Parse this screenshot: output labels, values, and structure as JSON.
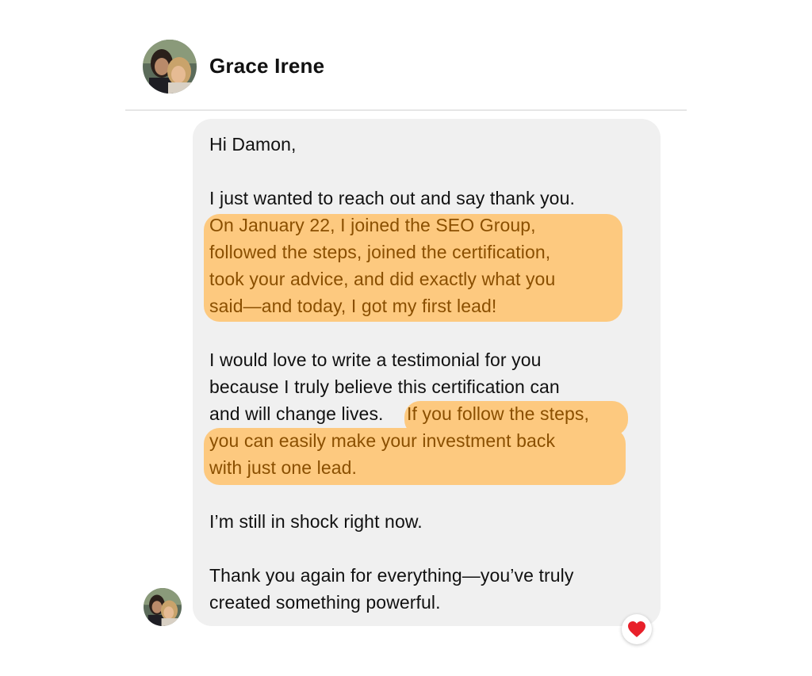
{
  "header": {
    "contact_name": "Grace Irene",
    "avatar_icon": "profile-photo-icon"
  },
  "message": {
    "lines": [
      {
        "text": "Hi Damon,",
        "highlight": false
      },
      {
        "text": "I just wanted to reach out and say thank you.",
        "highlight": false
      },
      {
        "text": "On January 22, I joined the SEO Group,",
        "highlight": true
      },
      {
        "text": "followed the steps, joined the certification,",
        "highlight": true
      },
      {
        "text": "took your advice, and did exactly what you",
        "highlight": true
      },
      {
        "text": "said—and today, I got my first lead!",
        "highlight": true
      },
      {
        "text": "I would love to write a testimonial for you",
        "highlight": false
      },
      {
        "text": "because I truly believe this certification can",
        "highlight": false
      },
      {
        "text": "and will change lives.",
        "highlight": false
      },
      {
        "text": " If you follow the steps,",
        "highlight": true
      },
      {
        "text": "you can easily make your investment back",
        "highlight": true
      },
      {
        "text": "with just one lead.",
        "highlight": true
      },
      {
        "text": "I’m still in shock right now.",
        "highlight": false
      },
      {
        "text": "Thank you again for everything—you’ve truly",
        "highlight": false
      },
      {
        "text": "created something powerful.",
        "highlight": false
      }
    ],
    "highlight_color": "#fdc97f",
    "highlight_text_color": "#8a4f00",
    "bubble_color": "#f0f0f0"
  },
  "reaction": {
    "icon": "heart-icon",
    "color": "#e8202a"
  }
}
